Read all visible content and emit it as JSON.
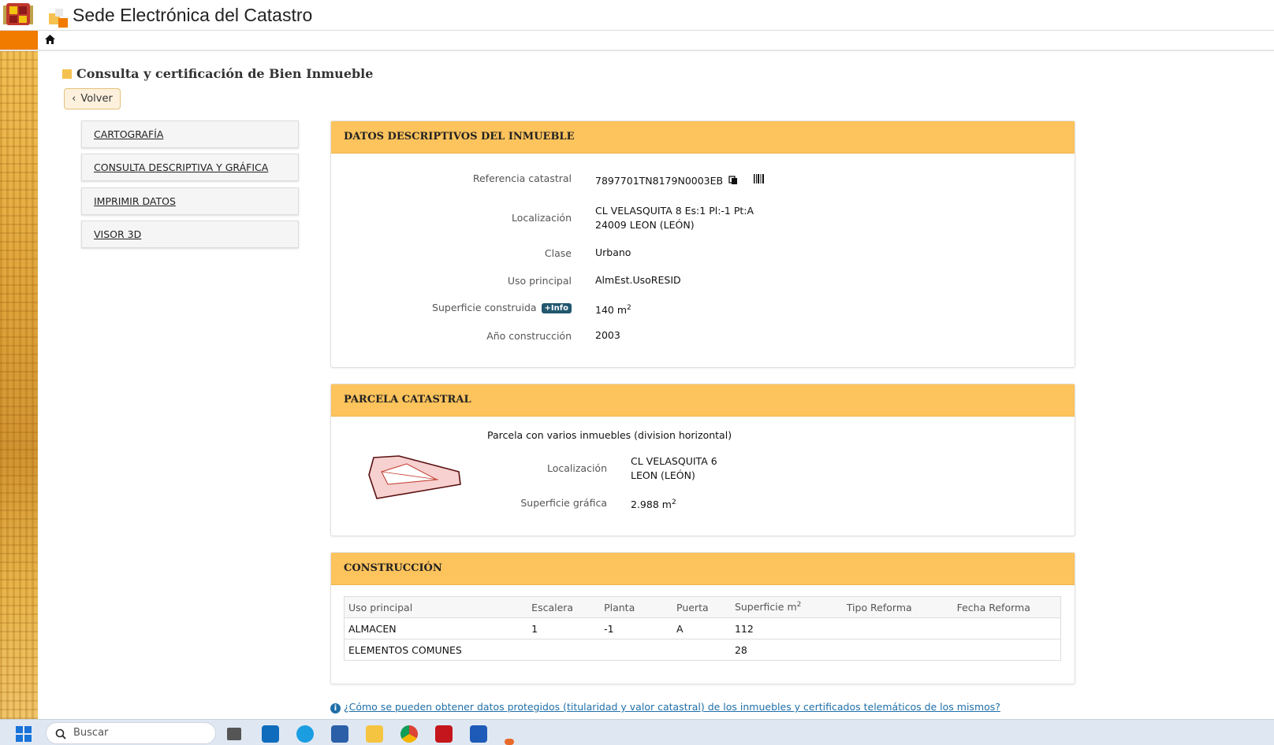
{
  "header": {
    "site_title": "Sede Electrónica del Catastro"
  },
  "page": {
    "title": "Consulta y certificación de Bien Inmueble",
    "back_label": "Volver"
  },
  "sidebar": {
    "items": [
      {
        "label": "CARTOGRAFÍA"
      },
      {
        "label": "CONSULTA DESCRIPTIVA Y GRÁFICA"
      },
      {
        "label": "IMPRIMIR DATOS"
      },
      {
        "label": "VISOR 3D"
      }
    ]
  },
  "datos": {
    "heading": "DATOS DESCRIPTIVOS DEL INMUEBLE",
    "ref_label": "Referencia catastral",
    "ref_value": "7897701TN8179N0003EB",
    "loc_label": "Localización",
    "loc_line1": "CL VELASQUITA 8 Es:1 Pl:-1 Pt:A",
    "loc_line2": "24009 LEON (LEÓN)",
    "clase_label": "Clase",
    "clase_value": "Urbano",
    "uso_label": "Uso principal",
    "uso_value": "AlmEst.UsoRESID",
    "sup_label": "Superficie construida",
    "info_badge": "+Info",
    "sup_value": "140 m",
    "sup_exp": "2",
    "anio_label": "Año construcción",
    "anio_value": "2003"
  },
  "parcela": {
    "heading": "PARCELA CATASTRAL",
    "subtitle": "Parcela con varios inmuebles (division horizontal)",
    "loc_label": "Localización",
    "loc_line1": "CL VELASQUITA 6",
    "loc_line2": "LEON (LEÓN)",
    "sup_label": "Superficie gráfica",
    "sup_value": "2.988 m",
    "sup_exp": "2"
  },
  "construccion": {
    "heading": "CONSTRUCCIÓN",
    "columns": [
      "Uso principal",
      "Escalera",
      "Planta",
      "Puerta",
      "Superficie m",
      "Tipo Reforma",
      "Fecha Reforma"
    ],
    "sup_exp": "2",
    "rows": [
      [
        "ALMACEN",
        "1",
        "-1",
        "A",
        "112",
        "",
        ""
      ],
      [
        "ELEMENTOS COMUNES",
        "",
        "",
        "",
        "28",
        "",
        ""
      ]
    ]
  },
  "footer": {
    "link": "¿Cómo se pueden obtener datos protegidos (titularidad y valor catastral) de los inmuebles y certificados telemáticos de los mismos?"
  },
  "taskbar": {
    "search_placeholder": "Buscar"
  },
  "colors": {
    "accent_orange": "#f07b00",
    "panel_header": "#fdc35c",
    "info_badge": "#21576f",
    "link": "#1f6fa8"
  }
}
